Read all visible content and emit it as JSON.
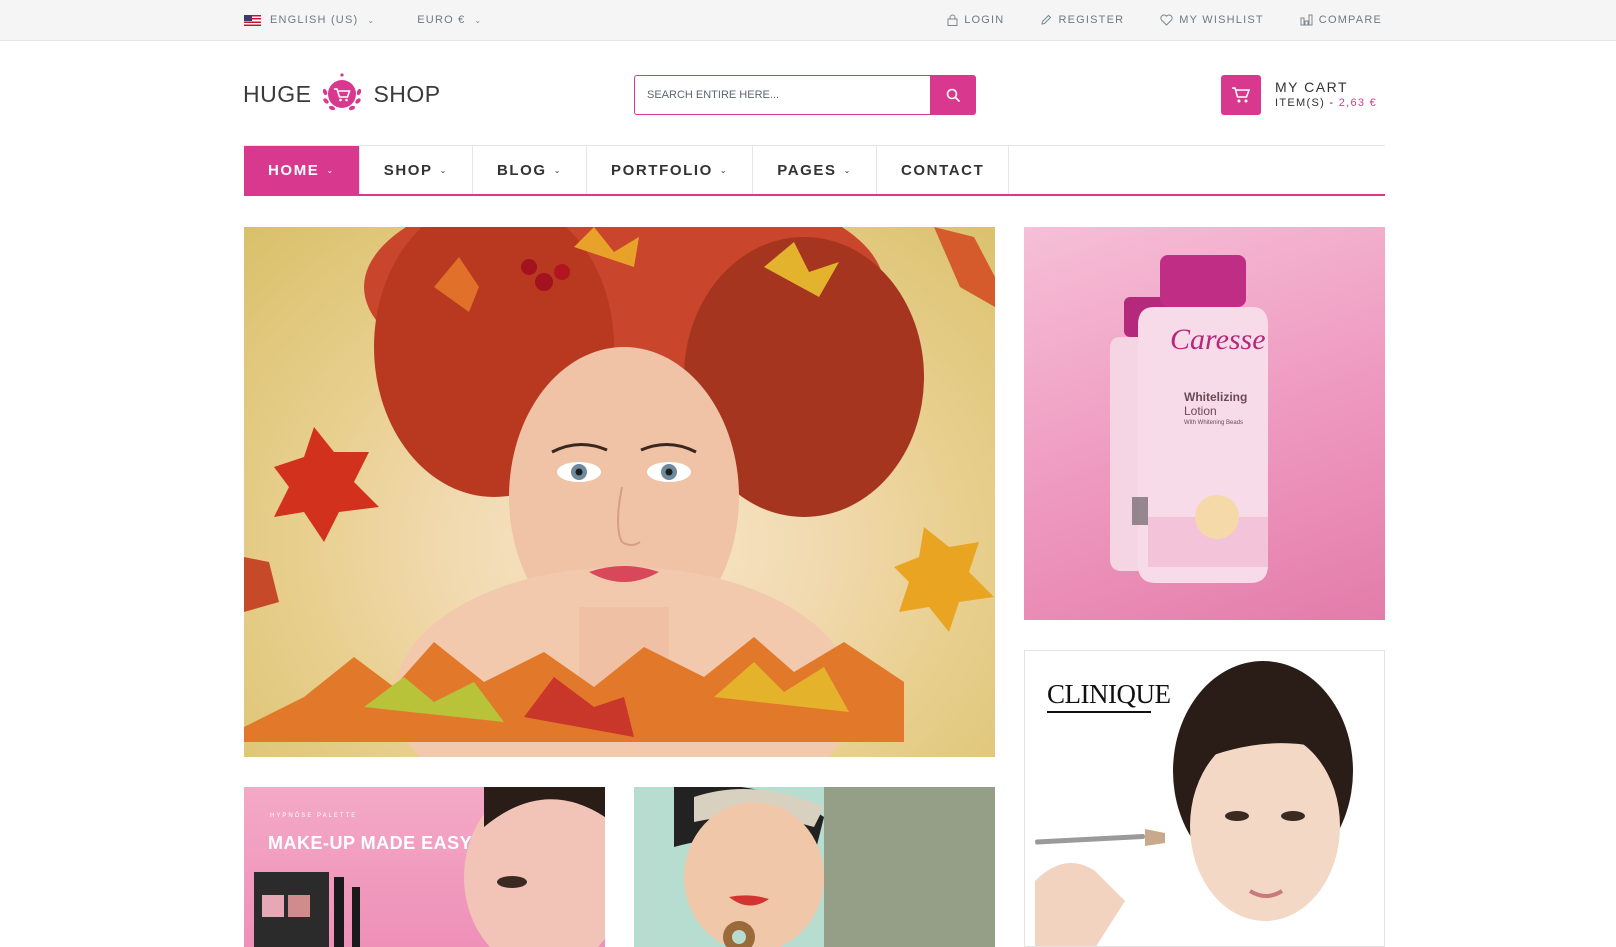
{
  "topbar": {
    "language": "ENGLISH (US)",
    "currency": "EURO €",
    "login": "LOGIN",
    "register": "REGISTER",
    "wishlist": "MY WISHLIST",
    "compare": "COMPARE"
  },
  "logo": {
    "left": "HUGE",
    "right": "SHOP"
  },
  "search": {
    "placeholder": "SEARCH ENTIRE HERE..."
  },
  "cart": {
    "title": "MY CART",
    "items_label": "ITEM(S) - ",
    "price": "2,63 €"
  },
  "nav": [
    "HOME",
    "SHOP",
    "BLOG",
    "PORTFOLIO",
    "PAGES",
    "CONTACT"
  ],
  "banners": {
    "caresse_brand": "Caresse",
    "caresse_product": "Whitelizing",
    "caresse_product2": "Lotion",
    "caresse_sub": "With Whitening Beads",
    "clinique_brand": "CLINIQUE",
    "makeup_small": "HYPNÔSE PALETTE",
    "makeup_title": "MAKE-UP MADE EASY"
  },
  "colors": {
    "accent": "#d9388f",
    "topbar_bg": "#f5f5f5",
    "text": "#333333"
  },
  "icons": [
    "flag-us-icon",
    "lock-icon",
    "pencil-icon",
    "heart-icon",
    "bar-chart-icon",
    "search-icon",
    "cart-icon"
  ]
}
